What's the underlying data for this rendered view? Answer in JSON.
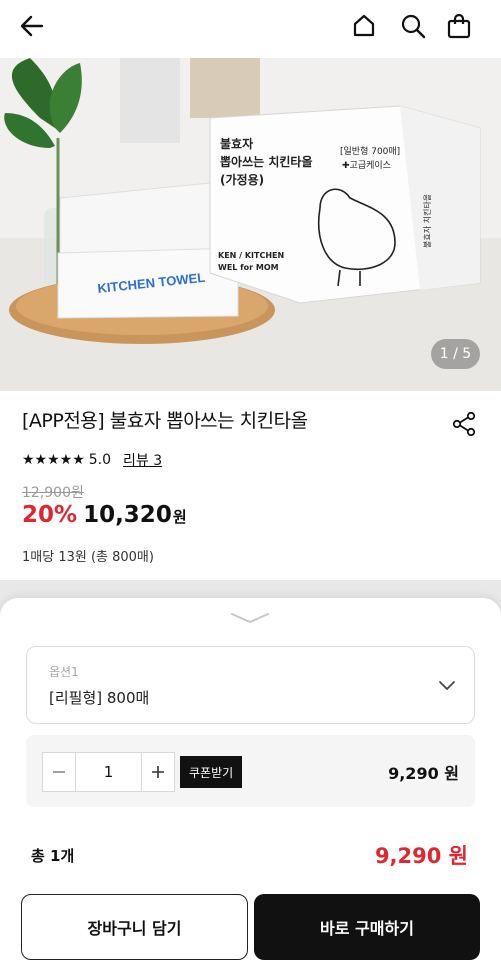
{
  "header": {
    "back_icon": "arrow-left-icon",
    "home_icon": "home-icon",
    "search_icon": "search-icon",
    "bag_icon": "shopping-bag-icon"
  },
  "gallery": {
    "pager": "1 / 5",
    "box_text": {
      "brand": "불효자",
      "line2": "뽑아쓰는 치킨타올",
      "line3": "(가정용)",
      "tag": "[일반형 700매]",
      "tag2": "✚고급케이스",
      "en1": "KEN / KITCHEN",
      "en2": "WEL for MOM",
      "side": "불효자 치킨타올 을 검색하세요!"
    },
    "towel_text": "KITCHEN TOWEL"
  },
  "product": {
    "title": "[APP전용] 불효자 뽑아쓰는 치킨타올",
    "stars": "★★★★★",
    "rating": "5.0",
    "review": "리뷰 3",
    "original_price": "12,900원",
    "discount": "20%",
    "price": "10,320",
    "won": "원",
    "unit_price": "1매당 13원 (총 800매)"
  },
  "sheet": {
    "option_label": "옵션1",
    "option_value": "[리필형] 800매",
    "quantity": "1",
    "coupon": "쿠폰받기",
    "line_price": "9,290 원",
    "total_label": "총 1개",
    "total_price": "9,290 원",
    "cart_button": "장바구니 담기",
    "buy_button": "바로 구매하기"
  },
  "colors": {
    "accent_red": "#e0272f",
    "dark": "#111111"
  }
}
